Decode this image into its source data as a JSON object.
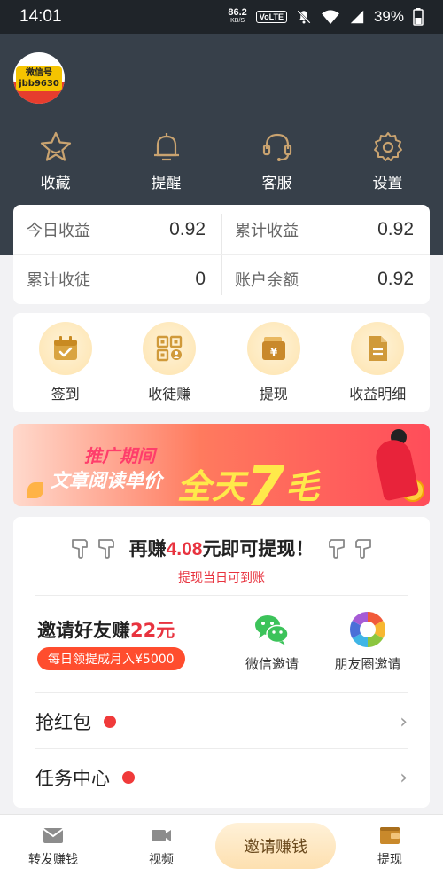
{
  "status_bar": {
    "time": "14:01",
    "net_speed_value": "86.2",
    "net_speed_unit": "KB/S",
    "volte": "VoLTE",
    "battery": "39%"
  },
  "profile": {
    "avatar_line1": "微信号",
    "avatar_line2": "jbb9630"
  },
  "top_actions": [
    {
      "label": "收藏",
      "icon": "star-icon"
    },
    {
      "label": "提醒",
      "icon": "bell-icon"
    },
    {
      "label": "客服",
      "icon": "headset-icon"
    },
    {
      "label": "设置",
      "icon": "gear-icon"
    }
  ],
  "stats": [
    {
      "label": "今日收益",
      "value": "0.92"
    },
    {
      "label": "累计收益",
      "value": "0.92"
    },
    {
      "label": "累计收徒",
      "value": "0"
    },
    {
      "label": "账户余额",
      "value": "0.92"
    }
  ],
  "quick_actions": [
    {
      "label": "签到",
      "icon": "calendar-check-icon"
    },
    {
      "label": "收徒赚",
      "icon": "qr-code-icon"
    },
    {
      "label": "提现",
      "icon": "wallet-yen-icon"
    },
    {
      "label": "收益明细",
      "icon": "document-icon"
    }
  ],
  "banner": {
    "line1": "推广期间",
    "line2": "文章阅读单价",
    "big_prefix": "全天",
    "big_number": "7",
    "big_suffix": "毛"
  },
  "withdraw": {
    "prefix": "再赚",
    "amount": "4.08",
    "suffix": "元即可提现！",
    "subtitle": "提现当日可到账"
  },
  "invite": {
    "title_prefix": "邀请好友赚",
    "title_amount": "22元",
    "pill": "每日领提成月入¥5000",
    "wechat_label": "微信邀请",
    "moments_label": "朋友圈邀请"
  },
  "menu_rows": [
    {
      "label": "抢红包"
    },
    {
      "label": "任务中心"
    }
  ],
  "bottom_nav": {
    "forward": "转发赚钱",
    "video": "视频",
    "invite": "邀请赚钱",
    "withdraw": "提现"
  },
  "colors": {
    "header_bg": "#37404a",
    "accent_red": "#e8333f",
    "gold_icon": "#c9973b"
  }
}
